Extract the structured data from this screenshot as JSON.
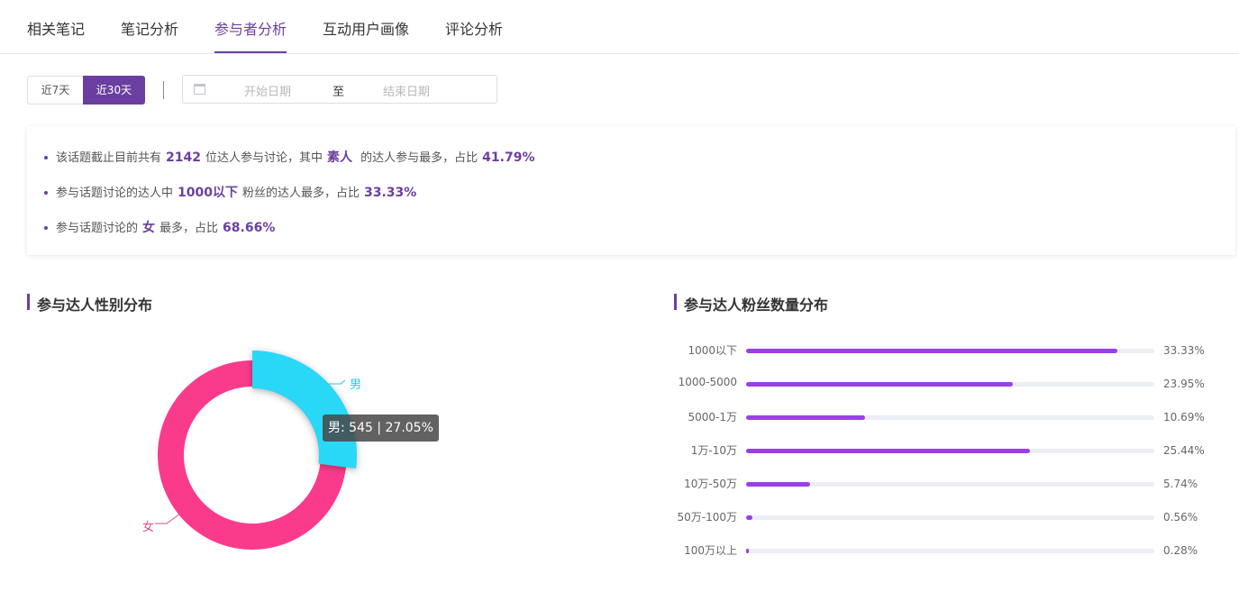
{
  "tabs": [
    "相关笔记",
    "笔记分析",
    "参与者分析",
    "互动用户画像",
    "评论分析"
  ],
  "active_tab": 2,
  "filters": {
    "range_7": "近7天",
    "range_30": "近30天",
    "date_start_placeholder": "开始日期",
    "date_separator": "至",
    "date_end_placeholder": "结束日期"
  },
  "summary": {
    "line1": {
      "pre": "该话题截止目前共有",
      "count": "2142",
      "mid": "位达人参与讨论，其中",
      "type": "素人",
      "post": "的达人参与最多，占比",
      "pct": "41.79%"
    },
    "line2": {
      "pre": "参与话题讨论的达人中",
      "bucket": "1000以下",
      "mid": "粉丝的达人最多，占比",
      "pct": "33.33%"
    },
    "line3": {
      "pre": "参与话题讨论的",
      "gender": "女",
      "mid": "最多，占比",
      "pct": "68.66%"
    }
  },
  "gender_section": {
    "title": "参与达人性别分布",
    "tooltip": "男: 545 | 27.05%",
    "label_male": "男",
    "label_female": "女",
    "colors": {
      "male": "#29d7f7",
      "female": "#fa3b8c"
    }
  },
  "fans_section": {
    "title": "参与达人粉丝数量分布",
    "bar_color": "#9b3fe8"
  },
  "chart_data": [
    {
      "type": "pie",
      "variant": "donut",
      "title": "参与达人性别分布",
      "series": [
        {
          "name": "男",
          "value": 545,
          "percent": 27.05
        },
        {
          "name": "女",
          "percent": 72.95
        }
      ]
    },
    {
      "type": "bar",
      "orientation": "horizontal",
      "title": "参与达人粉丝数量分布",
      "categories": [
        "1000以下",
        "1000-5000",
        "5000-1万",
        "1万-10万",
        "10万-50万",
        "50万-100万",
        "100万以上"
      ],
      "values": [
        33.33,
        23.95,
        10.69,
        25.44,
        5.74,
        0.56,
        0.28
      ],
      "value_labels": [
        "33.33%",
        "23.95%",
        "10.69%",
        "25.44%",
        "5.74%",
        "0.56%",
        "0.28%"
      ]
    }
  ]
}
